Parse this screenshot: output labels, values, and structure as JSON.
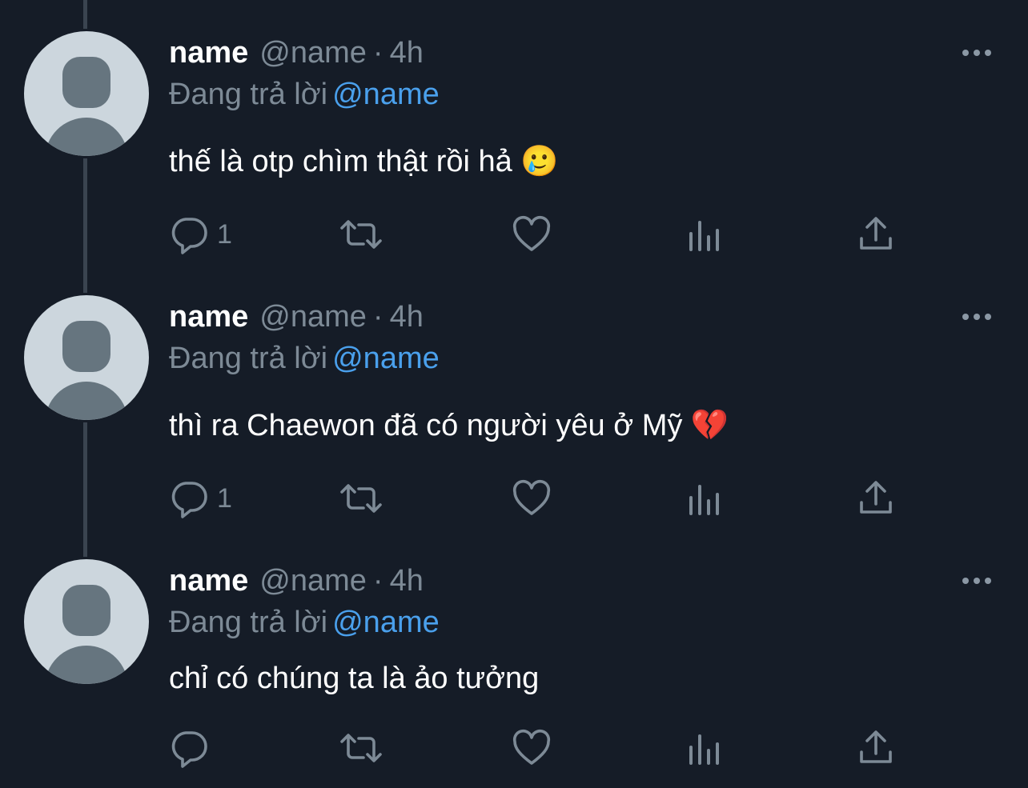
{
  "tweets": [
    {
      "display_name": "name",
      "handle": "@name",
      "separator": "·",
      "time": "4h",
      "reply_prefix": "Đang trả lời",
      "reply_mention": "@name",
      "text": "thế là otp chìm thật rồi hả 🥲",
      "reply_count": "1"
    },
    {
      "display_name": "name",
      "handle": "@name",
      "separator": "·",
      "time": "4h",
      "reply_prefix": "Đang trả lời",
      "reply_mention": "@name",
      "text": "thì ra Chaewon đã có người yêu ở Mỹ 💔",
      "reply_count": "1"
    },
    {
      "display_name": "name",
      "handle": "@name",
      "separator": "·",
      "time": "4h",
      "reply_prefix": "Đang trả lời",
      "reply_mention": "@name",
      "text": "chỉ có chúng ta là ảo tưởng",
      "reply_count": ""
    }
  ],
  "icons": {
    "reply": "reply-icon",
    "retweet": "retweet-icon",
    "like": "heart-icon",
    "stats": "analytics-icon",
    "share": "share-icon",
    "more": "more-icon"
  },
  "colors": {
    "background": "#151c27",
    "muted": "#7d8a96",
    "mention": "#4aa0ec",
    "thread_line": "#3a4450"
  }
}
